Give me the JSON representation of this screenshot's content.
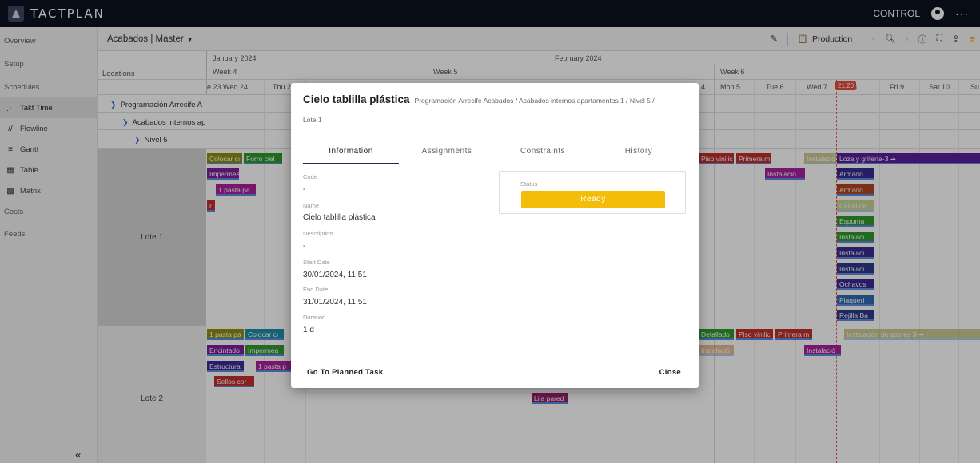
{
  "app": {
    "logo_text": "TACTPLAN",
    "user_label": "CONTROL",
    "more": "···"
  },
  "sidebar": {
    "items": [
      {
        "label": "Overview",
        "icon": ""
      },
      {
        "label": "Setup",
        "icon": ""
      },
      {
        "label": "Schedules",
        "icon": ""
      },
      {
        "label": "Takt Time",
        "icon": "takt-icon",
        "active": true
      },
      {
        "label": "Flowline",
        "icon": "flowline-icon"
      },
      {
        "label": "Gantt",
        "icon": "gantt-icon"
      },
      {
        "label": "Table",
        "icon": "table-icon"
      },
      {
        "label": "Matrix",
        "icon": "matrix-icon"
      },
      {
        "label": "Costs",
        "icon": ""
      },
      {
        "label": "Feeds",
        "icon": ""
      }
    ],
    "collapse": "«"
  },
  "toolbar": {
    "board": "Acabados | Master",
    "production_label": "Production"
  },
  "grid": {
    "locations_header": "Locations",
    "months": [
      "January 2024",
      "February 2024"
    ],
    "weeks": [
      "Week 4",
      "Week 5",
      "Week 6"
    ],
    "days": [
      "e 23",
      "Wed 24",
      "Thu 2",
      "4",
      "Mon 5",
      "Tue 6",
      "Wed 7",
      "8",
      "Fri 9",
      "Sat 10",
      "Su"
    ],
    "today_badge": "21:20",
    "tree": [
      "Programación Arrecife A",
      "Acabados internos ap",
      "Nivel 5"
    ],
    "lotes": [
      "Lote 1",
      "Lote 2"
    ]
  },
  "tasks": {
    "l1": [
      "Colocar cı",
      "Forro ciel",
      "Impermea",
      "1 pasta pa",
      "r",
      "Piso vinilic",
      "Primera m",
      "Instalació",
      "Loza y grifería-3",
      "Instalació",
      "Armado",
      "Armado",
      "Canal de",
      "Espuma",
      "Instalaci",
      "Instalaci",
      "Instalaci",
      "Ochavos",
      "Plaquerí",
      "Rejilla Ba"
    ],
    "l2": [
      "1 pasta pa",
      "Colocar cı",
      "Encintado",
      "Impermea",
      "Estructura",
      "1 pasta p",
      "Sellos cor",
      "Detallado",
      "Piso vinilic",
      "Primera m",
      "Instalación de sobres 3",
      "Instalació",
      "Instalació",
      "Lija pared"
    ]
  },
  "modal": {
    "title": "Cielo tablilla plástica",
    "path": "Programación Arrecife Acabados / Acabados internos apartamentos 1 / Nivel 5 /",
    "path2": "Lote 1",
    "tabs": [
      "Information",
      "Assignments",
      "Constraints",
      "History"
    ],
    "fields": {
      "code_label": "Code",
      "code_value": "-",
      "name_label": "Name",
      "name_value": "Cielo tablilla plástica",
      "description_label": "Description",
      "description_value": "-",
      "start_label": "Start Date",
      "start_value": "30/01/2024, 11:51",
      "end_label": "End Date",
      "end_value": "31/01/2024, 11:51",
      "duration_label": "Duration",
      "duration_value": "1 d"
    },
    "status_label": "Status",
    "status_value": "Ready",
    "go_button": "Go To Planned Task",
    "close_button": "Close"
  }
}
